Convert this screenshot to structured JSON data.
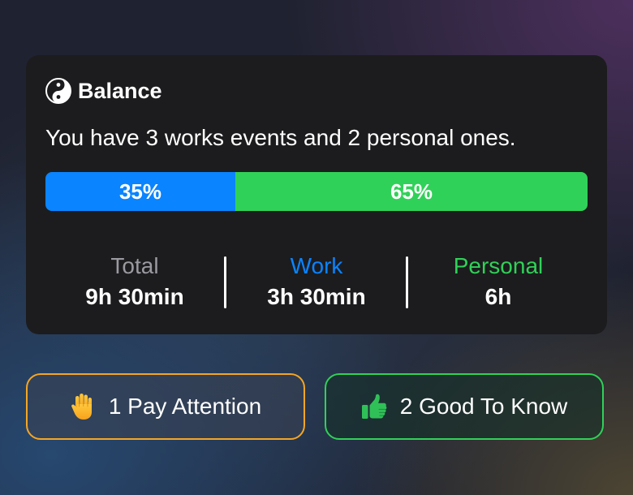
{
  "colors": {
    "card_background": "#1c1c1e",
    "work": "#0a84ff",
    "personal": "#30d158",
    "muted": "#9a9aa0",
    "attention": "#f5a623"
  },
  "card": {
    "icon": "yin-yang-icon",
    "title": "Balance",
    "summary": "You have 3 works events and 2 personal ones.",
    "bar": {
      "work": {
        "label": "35%",
        "fraction": 0.35
      },
      "personal": {
        "label": "65%",
        "fraction": 0.65
      }
    },
    "stats": {
      "total": {
        "label": "Total",
        "value": "9h 30min"
      },
      "work": {
        "label": "Work",
        "value": "3h 30min"
      },
      "personal": {
        "label": "Personal",
        "value": "6h"
      }
    }
  },
  "buttons": {
    "attention": {
      "icon": "raised-hand-icon",
      "label": "1 Pay Attention"
    },
    "good_to_know": {
      "icon": "thumbs-up-icon",
      "label": "2 Good To Know"
    }
  }
}
